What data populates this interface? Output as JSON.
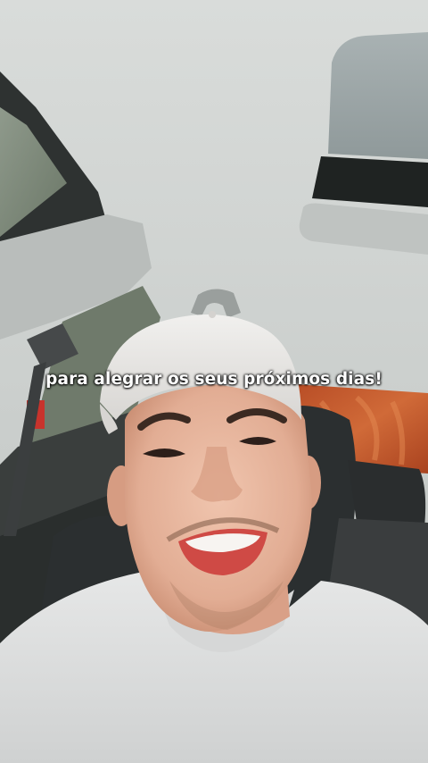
{
  "caption": {
    "text": "para alegrar os seus próximos dias!",
    "color": "#ffffff"
  },
  "palette": {
    "headliner": "#cfd2d0",
    "cap": "#e9e8e6",
    "shirt": "#e2e3e3",
    "skin": "#e4b39c",
    "lips": "#cf4a45",
    "rear_window_tint": "#c55a2e",
    "seat": "#2a2d2e"
  }
}
